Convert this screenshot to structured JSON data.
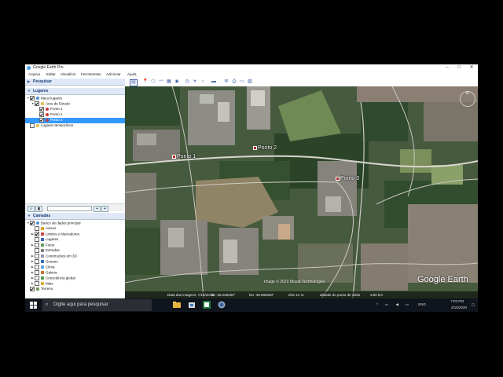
{
  "window": {
    "title": "Google Earth Pro",
    "controls": [
      "–",
      "□",
      "✕"
    ]
  },
  "menu": [
    "Arquivo",
    "Editar",
    "Visualizar",
    "Ferramentas",
    "Adicionar",
    "Ajuda"
  ],
  "panels": {
    "search_header": "Pesquisar",
    "places_header": "Lugares",
    "layers_header": "Camadas"
  },
  "places": [
    {
      "label": "Meus lugares",
      "checked": true,
      "expanded": true,
      "icon": "globe-folder-icon"
    },
    {
      "label": "Área de Estudo",
      "checked": true,
      "expanded": true,
      "icon": "folder-icon"
    },
    {
      "label": "Ponto 1",
      "checked": true,
      "icon": "placemark-icon"
    },
    {
      "label": "Ponto 2",
      "checked": true,
      "icon": "placemark-icon"
    },
    {
      "label": "Ponto 3",
      "checked": true,
      "selected": true,
      "icon": "placemark-icon"
    },
    {
      "label": "Lugares temporários",
      "checked": false,
      "icon": "folder-icon"
    }
  ],
  "layers": [
    {
      "label": "Banco de dados principal",
      "checked": true,
      "expanded": true,
      "icon": "globe-icon"
    },
    {
      "label": "Avisos",
      "checked": false,
      "icon": "warning-icon"
    },
    {
      "label": "Limites e Marcadores",
      "checked": true,
      "icon": "flag-icon"
    },
    {
      "label": "Lugares",
      "checked": false,
      "icon": "places-icon"
    },
    {
      "label": "Fotos",
      "checked": false,
      "icon": "photo-icon"
    },
    {
      "label": "Estradas",
      "checked": false,
      "icon": "road-icon"
    },
    {
      "label": "Construções em 3D",
      "checked": false,
      "icon": "building-icon"
    },
    {
      "label": "Oceano",
      "checked": false,
      "icon": "ocean-icon"
    },
    {
      "label": "Clima",
      "checked": false,
      "icon": "weather-icon"
    },
    {
      "label": "Galeria",
      "checked": false,
      "icon": "gallery-icon"
    },
    {
      "label": "Consciência global",
      "checked": false,
      "icon": "awareness-icon"
    },
    {
      "label": "Mais",
      "checked": false,
      "icon": "more-icon"
    },
    {
      "label": "Terreno",
      "checked": true,
      "icon": "terrain-icon"
    }
  ],
  "map": {
    "placemarks": [
      "Ponto 1",
      "Ponto 2",
      "Ponto 3"
    ],
    "copyright": "Image © 2020 Maxar Technologies",
    "logo": "Google Earth",
    "status": {
      "date": "Data das imagens: 7/15/2019",
      "lat": "lat -26.256320°",
      "lon": "lon -49.066320°",
      "elev": "elev  14 m",
      "eye": "altitude do ponto de visão",
      "eye_value": "3.50 km"
    },
    "nav": "N"
  },
  "taskbar": {
    "search_placeholder": "Digite aqui para pesquisar",
    "lang": "ENG",
    "time": "7:02 PM",
    "date": "4/15/2020"
  },
  "colors": {
    "selection": "#3399ff",
    "panel_header": "#dfe8f6",
    "taskbar": "#10141c"
  }
}
